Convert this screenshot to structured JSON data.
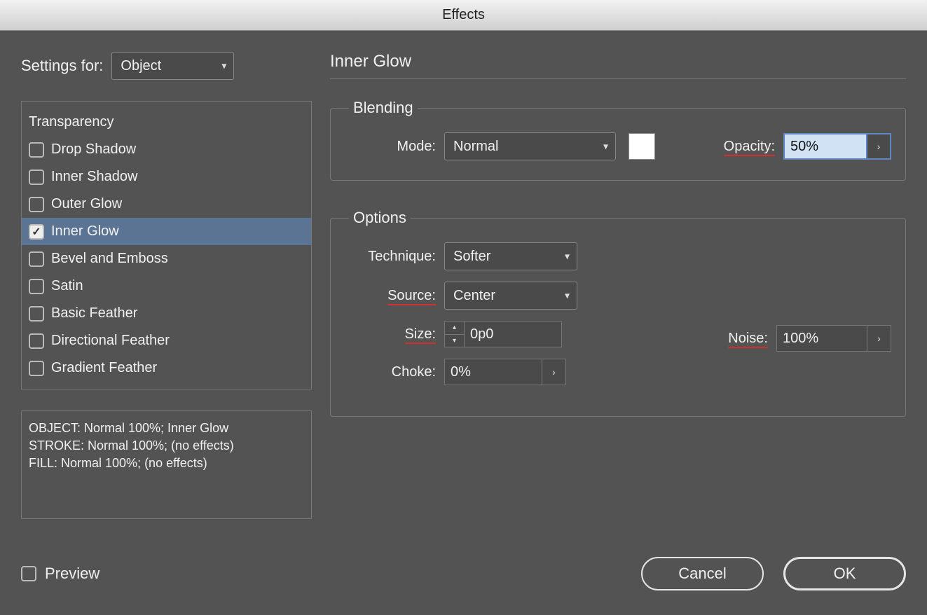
{
  "window_title": "Effects",
  "settings_for": {
    "label": "Settings for:",
    "value": "Object"
  },
  "effects_list": {
    "header": "Transparency",
    "items": [
      {
        "label": "Drop Shadow",
        "checked": false,
        "selected": false
      },
      {
        "label": "Inner Shadow",
        "checked": false,
        "selected": false
      },
      {
        "label": "Outer Glow",
        "checked": false,
        "selected": false
      },
      {
        "label": "Inner Glow",
        "checked": true,
        "selected": true
      },
      {
        "label": "Bevel and Emboss",
        "checked": false,
        "selected": false
      },
      {
        "label": "Satin",
        "checked": false,
        "selected": false
      },
      {
        "label": "Basic Feather",
        "checked": false,
        "selected": false
      },
      {
        "label": "Directional Feather",
        "checked": false,
        "selected": false
      },
      {
        "label": "Gradient Feather",
        "checked": false,
        "selected": false
      }
    ]
  },
  "summary": {
    "line1": "OBJECT: Normal 100%; Inner Glow",
    "line2": "STROKE: Normal 100%; (no effects)",
    "line3": "FILL: Normal 100%; (no effects)"
  },
  "panel_title": "Inner Glow",
  "blending": {
    "legend": "Blending",
    "mode_label": "Mode:",
    "mode_value": "Normal",
    "swatch_color": "#ffffff",
    "opacity_label": "Opacity:",
    "opacity_value": "50%"
  },
  "options": {
    "legend": "Options",
    "technique_label": "Technique:",
    "technique_value": "Softer",
    "source_label": "Source:",
    "source_value": "Center",
    "size_label": "Size:",
    "size_value": "0p0",
    "noise_label": "Noise:",
    "noise_value": "100%",
    "choke_label": "Choke:",
    "choke_value": "0%"
  },
  "preview_label": "Preview",
  "preview_checked": false,
  "buttons": {
    "cancel": "Cancel",
    "ok": "OK"
  }
}
